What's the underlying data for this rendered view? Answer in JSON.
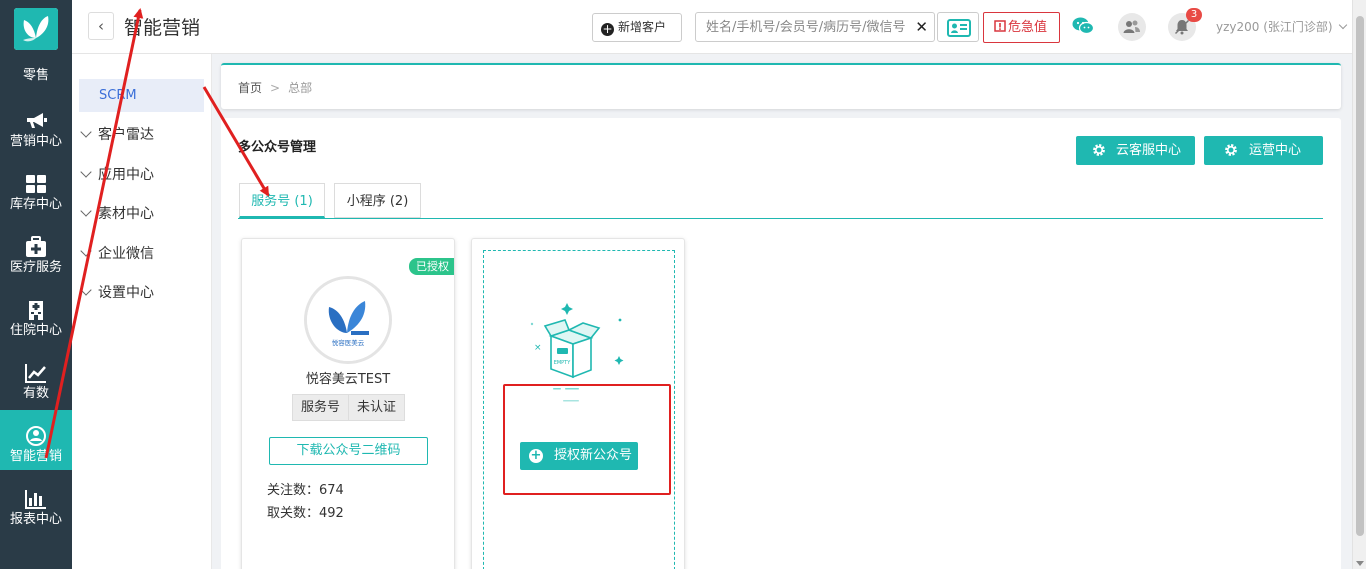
{
  "nav": {
    "items": [
      {
        "label": "零售",
        "icon": "none"
      },
      {
        "label": "营销中心",
        "icon": "megaphone-icon"
      },
      {
        "label": "库存中心",
        "icon": "grid-icon"
      },
      {
        "label": "医疗服务",
        "icon": "medical-kit-icon"
      },
      {
        "label": "住院中心",
        "icon": "hospital-icon"
      },
      {
        "label": "有数",
        "icon": "trend-chart-icon"
      },
      {
        "label": "智能营销",
        "icon": "smart-marketing-icon"
      },
      {
        "label": "报表中心",
        "icon": "bar-chart-icon"
      }
    ],
    "active_index": 6,
    "active_color": "#1fb8b1",
    "bg_color": "#2a3b47"
  },
  "header": {
    "back_glyph": "‹",
    "title": "智能营销",
    "add_customer": "新增客户",
    "search_placeholder": "姓名/手机号/会员号/病历号/微信号",
    "clear_glyph": "✕",
    "danger_label": "危急值",
    "notification_count": "3",
    "user": "yzy200 (张江门诊部)"
  },
  "submenu": {
    "active": "SCRM",
    "items": [
      "客户雷达",
      "应用中心",
      "素材中心",
      "企业微信",
      "设置中心"
    ]
  },
  "breadcrumb": {
    "home": "首页",
    "separator": ">",
    "current": "总部"
  },
  "panel": {
    "title": "多公众号管理",
    "btn_cloud_service": "云客服中心",
    "btn_operations": "运营中心",
    "tabs": [
      {
        "label": "服务号 (1)",
        "active": true
      },
      {
        "label": "小程序 (2)",
        "active": false
      }
    ]
  },
  "account_card": {
    "status": "已授权",
    "avatar_text": "悦容医美云",
    "name": "悦容美云TEST",
    "tags": [
      "服务号",
      "未认证"
    ],
    "qr_button": "下载公众号二维码",
    "followers_label": "关注数：",
    "followers": "674",
    "unfollow_label": "取关数：",
    "unfollow": "492"
  },
  "empty_card": {
    "empty_text": "EMPTY",
    "button": "授权新公众号"
  },
  "colors": {
    "accent": "#1fb8b1",
    "danger": "#d9363e",
    "success": "#2cc48b",
    "annotation": "#e02020",
    "link": "#3b6fd8"
  }
}
